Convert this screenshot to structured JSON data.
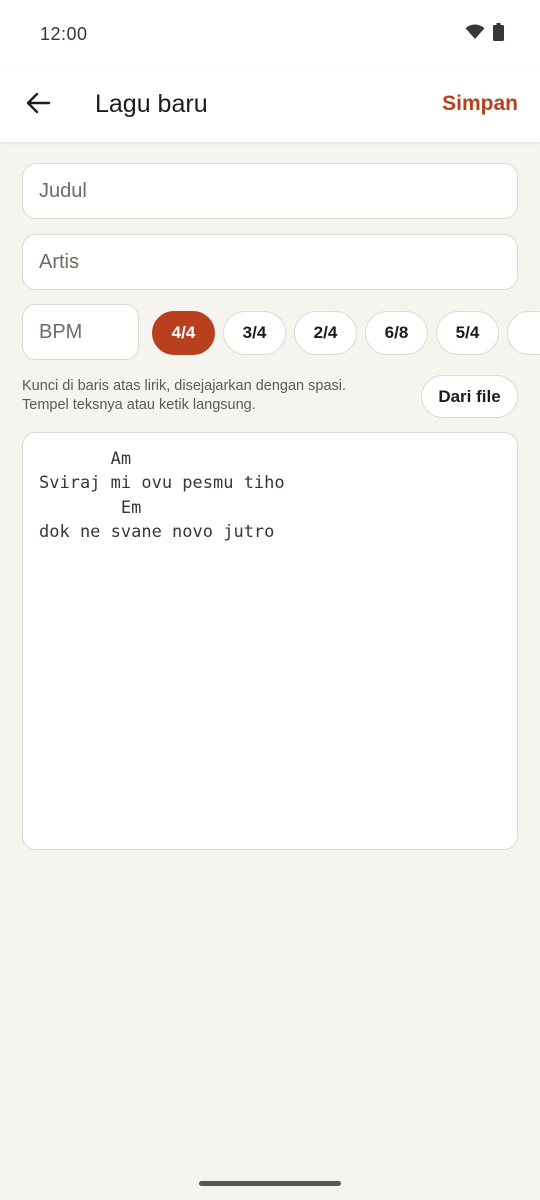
{
  "status_bar": {
    "time": "12:00",
    "icons": [
      "wifi-icon",
      "battery-icon"
    ]
  },
  "app_bar": {
    "back_icon": "arrow-left-icon",
    "title": "Lagu baru",
    "save_label": "Simpan"
  },
  "form": {
    "title_placeholder": "Judul",
    "title_value": "",
    "artist_placeholder": "Artis",
    "artist_value": "",
    "bpm_placeholder": "BPM",
    "bpm_value": ""
  },
  "time_signatures": {
    "options": [
      "4/4",
      "3/4",
      "2/4",
      "6/8",
      "5/4"
    ],
    "selected": "4/4"
  },
  "hint": {
    "line1": "Kunci di baris atas lirik, disejajarkan dengan spasi.",
    "line2": "Tempel teksnya atau ketik langsung."
  },
  "file_button_label": "Dari file",
  "editor": {
    "content": "       Am\nSviraj mi ovu pesmu tiho\n        Em\ndok ne svane novo jutro"
  },
  "colors": {
    "accent": "#B8401F",
    "background": "#F6F4EF",
    "surface": "#FFFFFF",
    "border": "#DEDAD2"
  }
}
